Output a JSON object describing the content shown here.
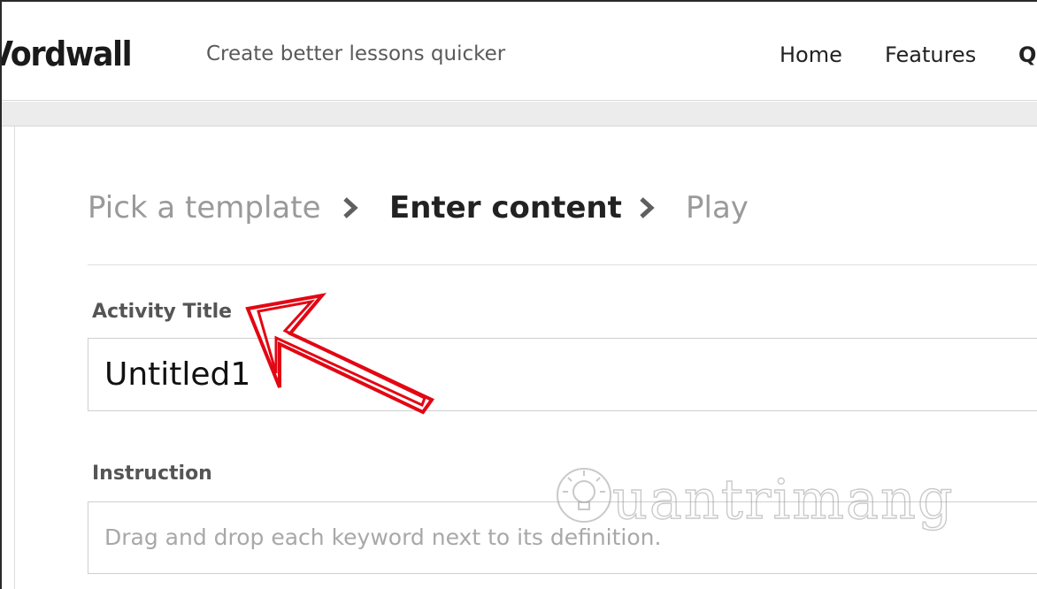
{
  "header": {
    "logo": "Vordwall",
    "tagline": "Create better lessons quicker",
    "nav": [
      {
        "label": "Home"
      },
      {
        "label": "Features"
      },
      {
        "label": "Q"
      }
    ]
  },
  "steps": {
    "items": [
      {
        "label": "Pick a template",
        "state": "done"
      },
      {
        "label": "Enter content",
        "state": "active"
      },
      {
        "label": "Play",
        "state": "upcoming"
      }
    ],
    "separator_icon": "chevron-right-icon"
  },
  "form": {
    "activity_title": {
      "label": "Activity Title",
      "value": "Untitled1"
    },
    "instruction": {
      "label": "Instruction",
      "placeholder": "Drag and drop each keyword next to its definition."
    }
  },
  "watermark": {
    "text": "uantrimang",
    "icon": "lightbulb-icon"
  },
  "annotation": {
    "icon": "arrow-icon",
    "color": "#e30613"
  },
  "colors": {
    "active_step": "#222222",
    "inactive_step": "#9a9a9a",
    "band": "#ececec"
  }
}
